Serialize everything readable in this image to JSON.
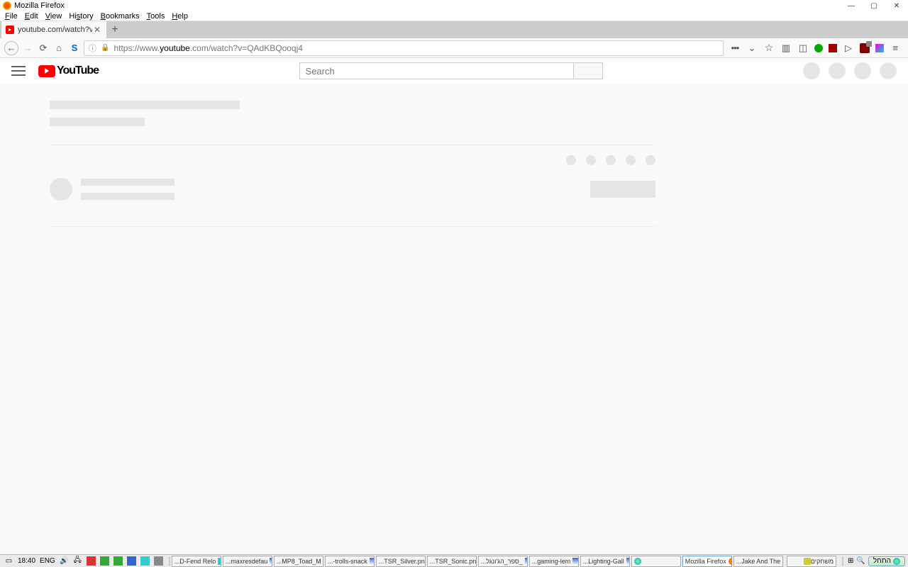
{
  "window": {
    "title": "Mozilla Firefox"
  },
  "menu": {
    "file": "File",
    "edit": "Edit",
    "view": "View",
    "history": "History",
    "bookmarks": "Bookmarks",
    "tools": "Tools",
    "help": "Help"
  },
  "tab": {
    "title": "youtube.com/watch?v=QAdK"
  },
  "url": {
    "prefix": "https://www.",
    "domain": "youtube",
    "suffix": ".com/watch?v=QAdKBQooqj4"
  },
  "youtube": {
    "logo_text": "YouTube",
    "search_placeholder": "Search"
  },
  "taskbar": {
    "time": "18:40",
    "lang": "ENG",
    "items": [
      "...D-Fend Relo",
      "...maxresdefau",
      "...MP8_Toad_M",
      "...-trolls-snack",
      "...TSR_Silver.pn",
      "...TSR_Sonic.pn",
      "...ספר_הג'ונגל_",
      "...gaming-lem",
      "...Lighting-Gall",
      "Mozilla Firefox",
      "...Jake And The"
    ],
    "folder": "משחקים",
    "start": "התחל"
  }
}
